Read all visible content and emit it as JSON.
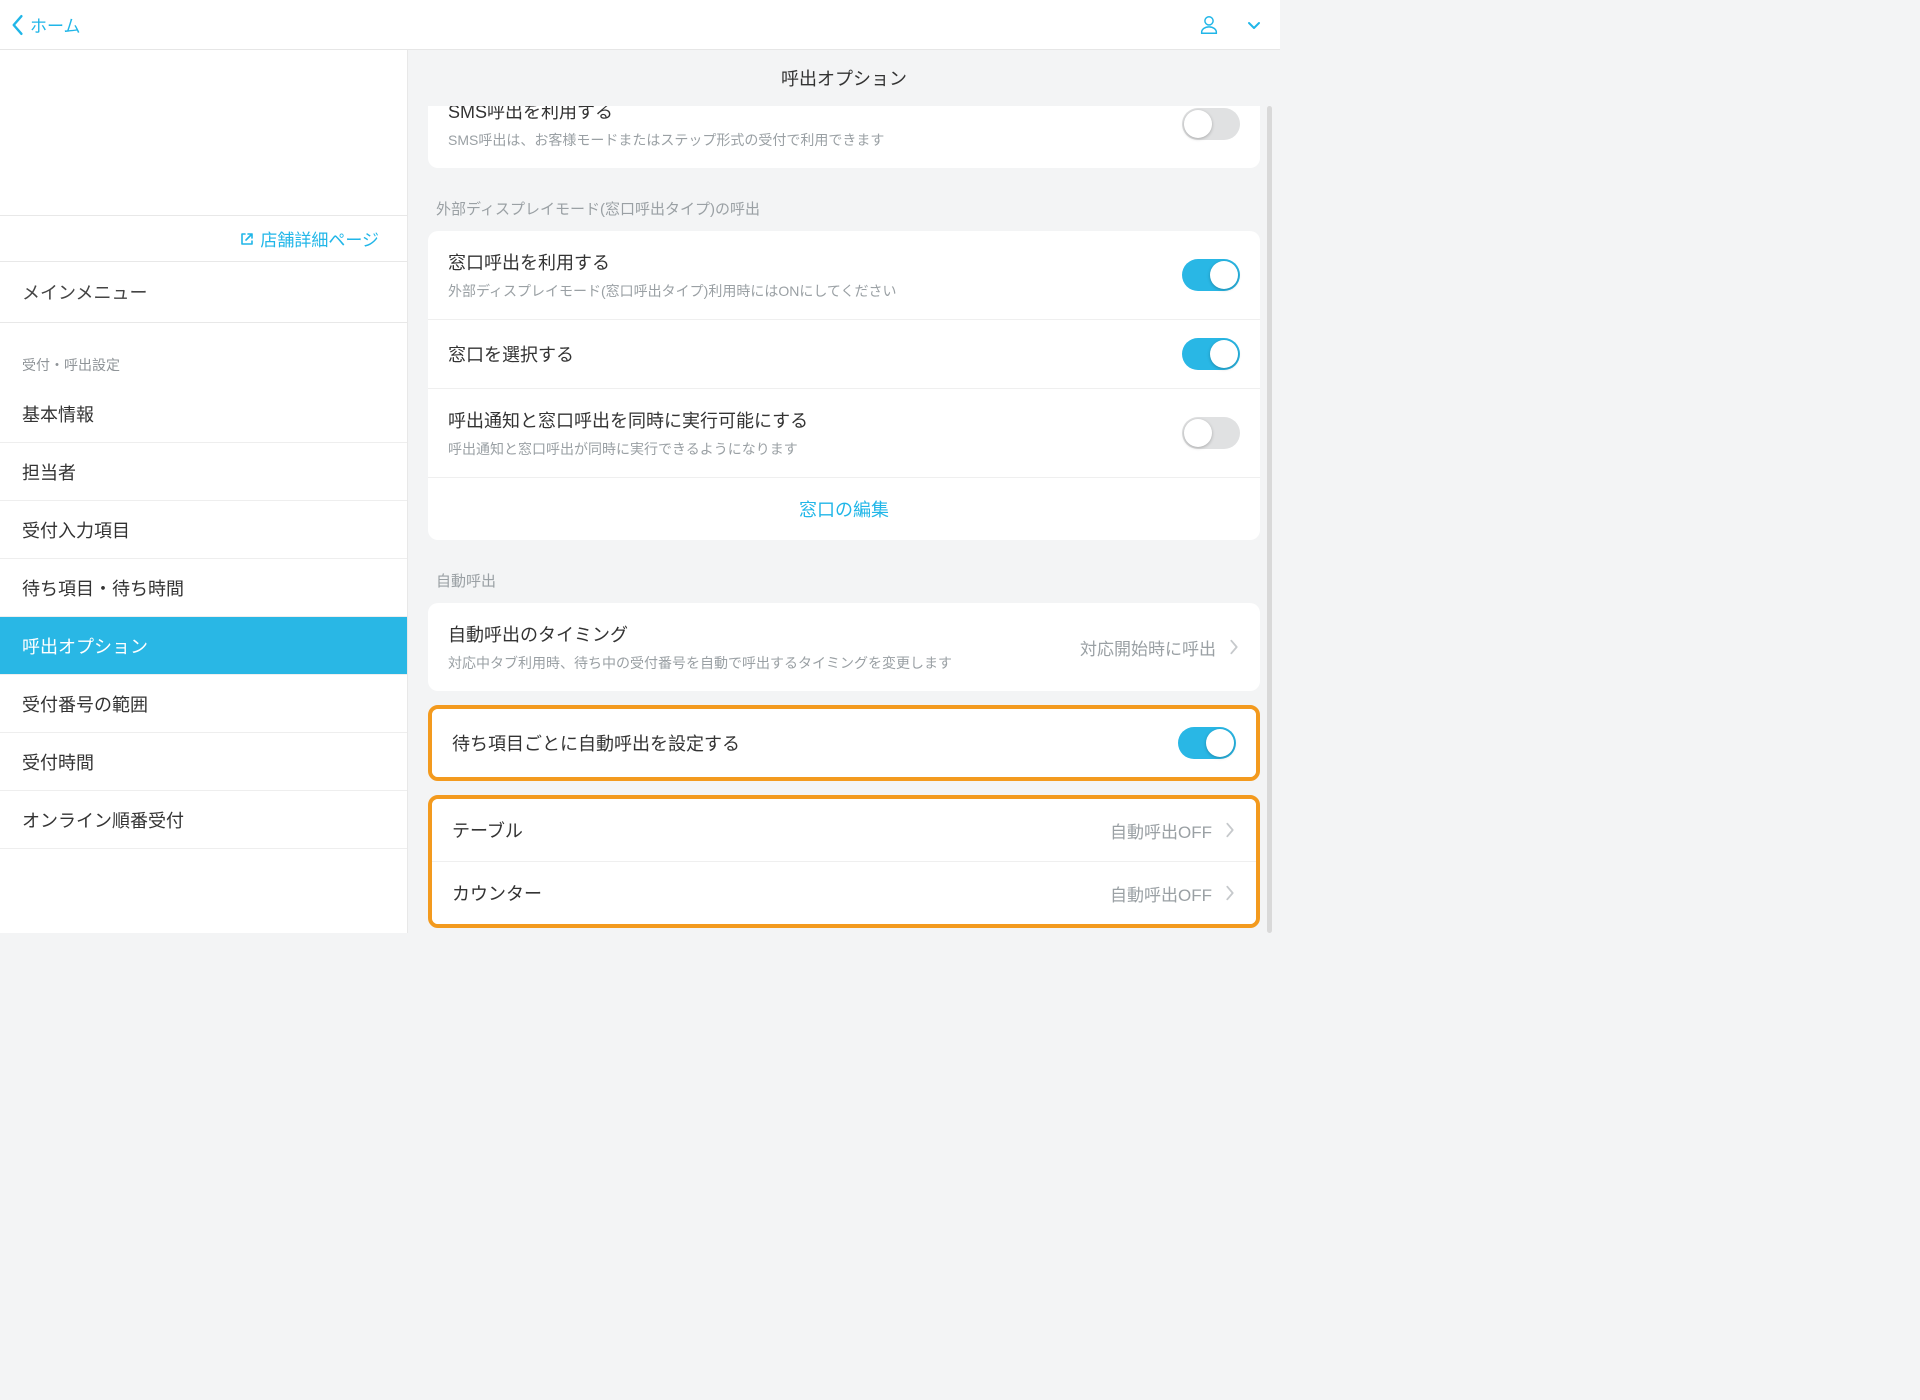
{
  "topbar": {
    "back_label": "ホーム"
  },
  "sidebar": {
    "store_detail_link": "店舗詳細ページ",
    "main_menu_label": "メインメニュー",
    "section_label": "受付・呼出設定",
    "items": [
      {
        "label": "基本情報"
      },
      {
        "label": "担当者"
      },
      {
        "label": "受付入力項目"
      },
      {
        "label": "待ち項目・待ち時間"
      },
      {
        "label": "呼出オプション"
      },
      {
        "label": "受付番号の範囲"
      },
      {
        "label": "受付時間"
      },
      {
        "label": "オンライン順番受付"
      }
    ]
  },
  "main": {
    "page_title": "呼出オプション",
    "sms": {
      "title": "SMS呼出を利用する",
      "desc": "SMS呼出は、お客様モードまたはステップ形式の受付で利用できます"
    },
    "display_section_label": "外部ディスプレイモード(窓口呼出タイプ)の呼出",
    "display": {
      "use_window_title": "窓口呼出を利用する",
      "use_window_desc": "外部ディスプレイモード(窓口呼出タイプ)利用時にはONにしてください",
      "select_window_title": "窓口を選択する",
      "simul_title": "呼出通知と窓口呼出を同時に実行可能にする",
      "simul_desc": "呼出通知と窓口呼出が同時に実行できるようになります",
      "edit_link": "窓口の編集"
    },
    "auto_section_label": "自動呼出",
    "auto": {
      "timing_title": "自動呼出のタイミング",
      "timing_desc": "対応中タブ利用時、待ち中の受付番号を自動で呼出するタイミングを変更します",
      "timing_value": "対応開始時に呼出",
      "per_item_title": "待ち項目ごとに自動呼出を設定する",
      "items": [
        {
          "name": "テーブル",
          "value": "自動呼出OFF"
        },
        {
          "name": "カウンター",
          "value": "自動呼出OFF"
        }
      ]
    }
  }
}
